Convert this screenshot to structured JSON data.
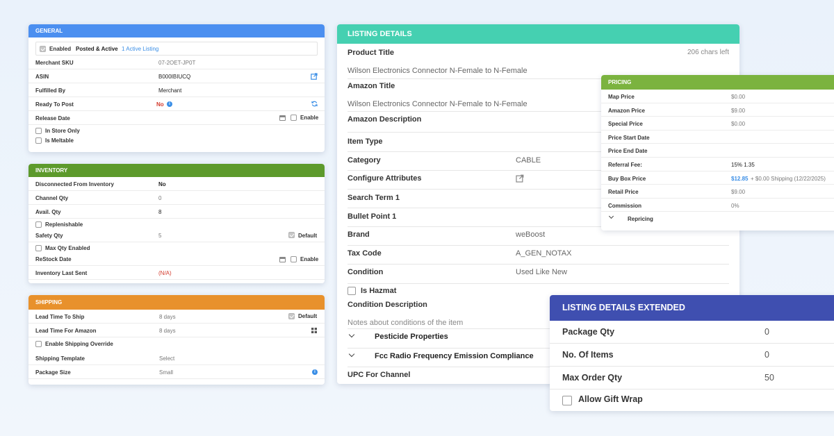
{
  "general": {
    "header": "GENERAL",
    "enabled_label": "Enabled",
    "status": "Posted & Active",
    "active_link": "1 Active Listing",
    "merchant_sku_label": "Merchant SKU",
    "merchant_sku": "07-2OET-JP0T",
    "asin_label": "ASIN",
    "asin": "B000IBIUCQ",
    "fulfilled_by_label": "Fulfilled By",
    "fulfilled_by": "Merchant",
    "ready_to_post_label": "Ready To Post",
    "ready_to_post": "No",
    "release_date_label": "Release Date",
    "enable_label": "Enable",
    "in_store_only_label": "In Store Only",
    "is_meltable_label": "Is Meltable"
  },
  "inventory": {
    "header": "INVENTORY",
    "disconnected_label": "Disconnected From Inventory",
    "disconnected": "No",
    "channel_qty_label": "Channel Qty",
    "channel_qty": "0",
    "avail_qty_label": "Avail. Qty",
    "avail_qty": "8",
    "replenishable_label": "Replenishable",
    "safety_qty_label": "Safety Qty",
    "safety_qty": "5",
    "default_label": "Default",
    "max_qty_label": "Max Qty Enabled",
    "restock_label": "ReStock Date",
    "enable_label": "Enable",
    "last_sent_label": "Inventory Last Sent",
    "last_sent": "(N/A)"
  },
  "shipping": {
    "header": "SHIPPING",
    "lead_time_label": "Lead Time To Ship",
    "lead_time": "8 days",
    "default_label": "Default",
    "lead_time_amazon_label": "Lead Time For Amazon",
    "lead_time_amazon": "8 days",
    "override_label": "Enable Shipping Override",
    "template_label": "Shipping Template",
    "template": "Select",
    "package_size_label": "Package Size",
    "package_size": "Small"
  },
  "listing": {
    "header": "LISTING DETAILS",
    "product_title_label": "Product Title",
    "chars_left": "206 chars left",
    "product_title": "Wilson Electronics Connector N-Female to N-Female",
    "amazon_title_label": "Amazon Title",
    "amazon_title": "Wilson Electronics Connector N-Female to N-Female",
    "amazon_description_label": "Amazon Description",
    "item_type_label": "Item Type",
    "category_label": "Category",
    "category": "CABLE",
    "configure_label": "Configure Attributes",
    "search_term_label": "Search Term 1",
    "bullet_label": "Bullet Point 1",
    "brand_label": "Brand",
    "brand": "weBoost",
    "tax_code_label": "Tax Code",
    "tax_code": "A_GEN_NOTAX",
    "condition_label": "Condition",
    "condition": "Used Like New",
    "hazmat_label": "Is Hazmat",
    "condition_desc_label": "Condition Description",
    "condition_desc_placeholder": "Notes about conditions of the item",
    "pesticide_label": "Pesticide Properties",
    "fcc_label": "Fcc Radio Frequency Emission Compliance",
    "upc_label": "UPC For Channel"
  },
  "pricing": {
    "header": "PRICING",
    "map_label": "Map Price",
    "map": "$0.00",
    "amazon_label": "Amazon Price",
    "amazon": "$9.00",
    "special_label": "Special Price",
    "special": "$0.00",
    "start_label": "Price Start Date",
    "end_label": "Price End Date",
    "referral_label": "Referral Fee:",
    "referral": "15% 1.35",
    "buybox_label": "Buy Box Price",
    "buybox_price": "$12.85",
    "buybox_rest": "+ $0.00 Shipping (12/22/2025)",
    "retail_label": "Retail Price",
    "retail": "$9.00",
    "commission_label": "Commission",
    "commission": "0%",
    "repricing_label": "Repricing"
  },
  "extended": {
    "header": "LISTING DETAILS EXTENDED",
    "package_qty_label": "Package Qty",
    "package_qty": "0",
    "items_label": "No. Of Items",
    "items": "0",
    "max_order_label": "Max Order Qty",
    "max_order": "50",
    "gift_wrap_label": "Allow Gift Wrap"
  },
  "colors": {
    "general": "#4b8ff0",
    "inventory": "#5d9a2c",
    "shipping": "#e8912c",
    "listing": "#45d0b1",
    "pricing": "#7bb33f",
    "extended": "#3f4fb0",
    "link": "#3a8ee6",
    "danger": "#d33a2c"
  }
}
